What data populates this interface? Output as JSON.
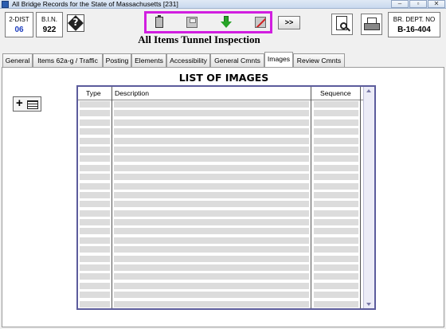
{
  "window": {
    "title": "All Bridge Records for the State of Massachusetts [231]",
    "controls": [
      "minimize",
      "restore",
      "close"
    ]
  },
  "header": {
    "district": {
      "label": "2-DIST",
      "value": "06"
    },
    "bin": {
      "label": "B.I.N.",
      "value": "922"
    },
    "dept_no": {
      "label": "BR. DEPT. NO",
      "value": "B-16-404"
    },
    "screen_title": "All Items Tunnel Inspection",
    "more_button": ">>",
    "toolbar_icons": [
      "clipboard-icon",
      "save-disk-icon",
      "download-arrow-icon",
      "no-save-icon"
    ]
  },
  "tabs": [
    {
      "label": "General"
    },
    {
      "label": "Items 62a-g / Traffic"
    },
    {
      "label": "Posting"
    },
    {
      "label": "Elements"
    },
    {
      "label": "Accessibility"
    },
    {
      "label": "General Cmnts"
    },
    {
      "label": "Images",
      "active": true
    },
    {
      "label": "Review Cmnts"
    }
  ],
  "images_panel": {
    "heading": "LIST OF IMAGES",
    "columns": [
      "Type",
      "Description",
      "Sequence"
    ],
    "row_count": 23,
    "rows": []
  },
  "colors": {
    "toolbar_highlight": "#d11ee0",
    "table_border": "#5c5c9c",
    "district_value": "#1f3fbf"
  }
}
